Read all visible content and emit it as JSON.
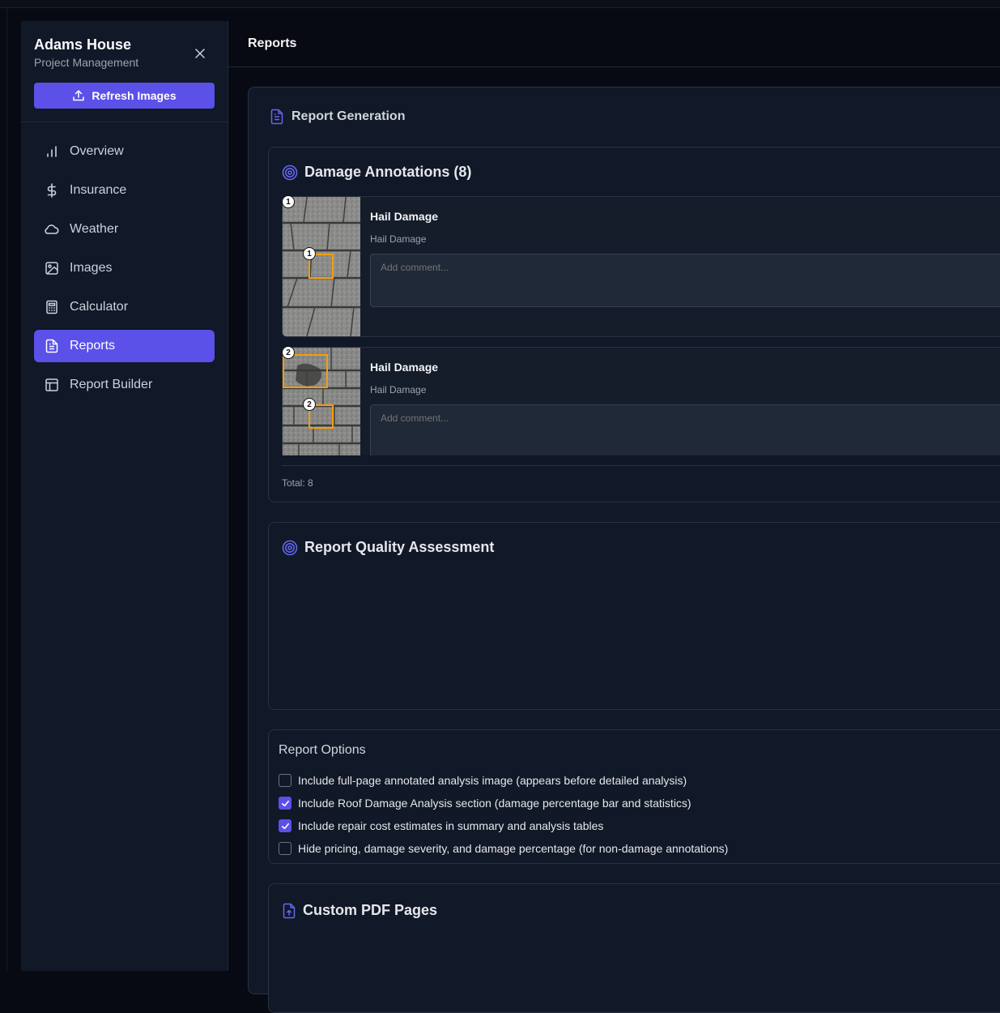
{
  "sidebar": {
    "project_title": "Adams House",
    "project_subtitle": "Project Management",
    "refresh_label": "Refresh Images",
    "items": [
      {
        "label": "Overview",
        "icon": "bar-chart-icon",
        "active": false
      },
      {
        "label": "Insurance",
        "icon": "dollar-icon",
        "active": false
      },
      {
        "label": "Weather",
        "icon": "cloud-icon",
        "active": false
      },
      {
        "label": "Images",
        "icon": "image-icon",
        "active": false
      },
      {
        "label": "Calculator",
        "icon": "calculator-icon",
        "active": false
      },
      {
        "label": "Reports",
        "icon": "file-text-icon",
        "active": true
      },
      {
        "label": "Report Builder",
        "icon": "layout-icon",
        "active": false
      }
    ]
  },
  "header": {
    "title": "Reports"
  },
  "panel": {
    "title": "Report Generation"
  },
  "annotations": {
    "title": "Damage Annotations (8)",
    "items": [
      {
        "number": "1",
        "title": "Hail Damage",
        "subtitle": "Hail Damage",
        "comment_placeholder": "Add comment..."
      },
      {
        "number": "2",
        "title": "Hail Damage",
        "subtitle": "Hail Damage",
        "comment_placeholder": "Add comment..."
      }
    ],
    "total": "Total: 8"
  },
  "quality": {
    "title": "Report Quality Assessment"
  },
  "options": {
    "title": "Report Options",
    "items": [
      {
        "label": "Include full-page annotated analysis image (appears before detailed analysis)",
        "checked": false
      },
      {
        "label": "Include Roof Damage Analysis section (damage percentage bar and statistics)",
        "checked": true
      },
      {
        "label": "Include repair cost estimates in summary and analysis tables",
        "checked": true
      },
      {
        "label": "Hide pricing, damage severity, and damage percentage (for non-damage annotations)",
        "checked": false
      }
    ]
  },
  "custom_pdf": {
    "title": "Custom PDF Pages"
  },
  "colors": {
    "accent": "#5b50e8",
    "annotation_box": "#f59e0b"
  }
}
